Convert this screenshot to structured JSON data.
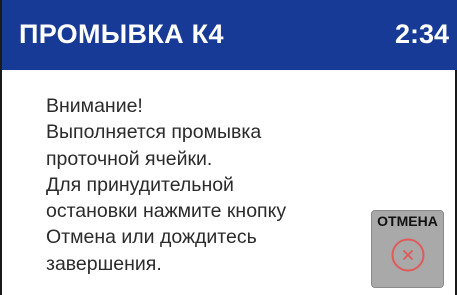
{
  "header": {
    "title": "ПРОМЫВКА К4",
    "timer": "2:34",
    "background_color": "#173a96"
  },
  "message": {
    "lines": [
      "Внимание!",
      "Выполняется промывка",
      "проточной ячейки.",
      "Для принудительной",
      "остановки нажмите кнопку",
      "Отмена или дождитесь",
      "завершения."
    ]
  },
  "cancel_button": {
    "label": "ОТМЕНА",
    "icon": "close-circle-icon",
    "icon_color": "#e05a5a",
    "background_color": "#a9a9a9"
  }
}
